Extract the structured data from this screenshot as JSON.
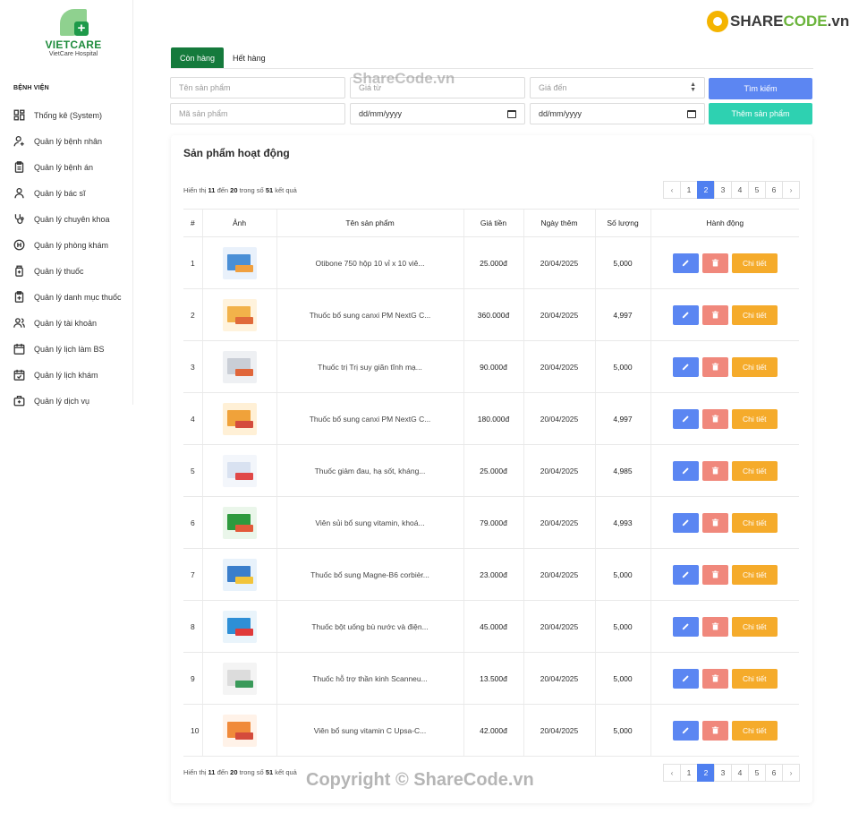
{
  "logo": {
    "name": "VIETCARE",
    "subtitle": "VietCare Hospital"
  },
  "brand": {
    "text_a": "SHARE",
    "text_b": "CODE",
    "text_c": ".vn"
  },
  "sidebar": {
    "section": "BỆNH VIỆN",
    "items": [
      {
        "label": "Thống kê (System)",
        "icon": "dashboard-icon"
      },
      {
        "label": "Quản lý bệnh nhân",
        "icon": "user-plus-icon"
      },
      {
        "label": "Quản lý bệnh án",
        "icon": "clipboard-icon"
      },
      {
        "label": "Quản lý bác sĩ",
        "icon": "user-icon"
      },
      {
        "label": "Quản lý chuyên khoa",
        "icon": "stethoscope-icon"
      },
      {
        "label": "Quản lý phòng khám",
        "icon": "hospital-icon"
      },
      {
        "label": "Quản lý thuốc",
        "icon": "medicine-bottle-icon"
      },
      {
        "label": "Quản lý danh mục thuốc",
        "icon": "clipboard-medical-icon"
      },
      {
        "label": "Quản lý tài khoản",
        "icon": "users-icon"
      },
      {
        "label": "Quản lý lịch làm BS",
        "icon": "calendar-icon"
      },
      {
        "label": "Quản lý lịch khám",
        "icon": "calendar-check-icon"
      },
      {
        "label": "Quản lý dịch vụ",
        "icon": "briefcase-medical-icon"
      }
    ]
  },
  "tabs": {
    "active": "Còn hàng",
    "inactive": "Hết hàng"
  },
  "filters": {
    "name_placeholder": "Tên sản phẩm",
    "price_from_placeholder": "Giá từ",
    "price_to_placeholder": "Giá đến",
    "code_placeholder": "Mã sản phẩm",
    "date_from": "dd/mm/yyyy",
    "date_to": "dd/mm/yyyy",
    "search_label": "Tìm kiếm",
    "add_label": "Thêm sản phẩm"
  },
  "card": {
    "title": "Sản phẩm hoạt động",
    "info_prefix": "Hiển thị",
    "info_from": "11",
    "info_mid": "đến",
    "info_to": "20",
    "info_mid2": "trong số",
    "info_total": "51",
    "info_suffix": "kết quả"
  },
  "pagination": {
    "prev": "‹",
    "next": "›",
    "pages": [
      "1",
      "2",
      "3",
      "4",
      "5",
      "6"
    ],
    "active_page": "2"
  },
  "table": {
    "headers": [
      "#",
      "Ảnh",
      "Tên sản phẩm",
      "Giá tiền",
      "Ngày thêm",
      "Số lượng",
      "Hành động"
    ],
    "detail_label": "Chi tiết",
    "rows": [
      {
        "idx": "1",
        "name": "Otibone 750 hộp 10 vỉ x 10 viê...",
        "price": "25.000đ",
        "date": "20/04/2025",
        "qty": "5,000"
      },
      {
        "idx": "2",
        "name": "Thuốc bổ sung canxi PM NextG C...",
        "price": "360.000đ",
        "date": "20/04/2025",
        "qty": "4,997"
      },
      {
        "idx": "3",
        "name": "Thuốc trị Trị suy giãn tĩnh mạ...",
        "price": "90.000đ",
        "date": "20/04/2025",
        "qty": "5,000"
      },
      {
        "idx": "4",
        "name": "Thuốc bổ sung canxi PM NextG C...",
        "price": "180.000đ",
        "date": "20/04/2025",
        "qty": "4,997"
      },
      {
        "idx": "5",
        "name": "Thuốc giảm đau, hạ sốt, kháng...",
        "price": "25.000đ",
        "date": "20/04/2025",
        "qty": "4,985"
      },
      {
        "idx": "6",
        "name": "Viên sủi bổ sung vitamin, khoá...",
        "price": "79.000đ",
        "date": "20/04/2025",
        "qty": "4,993"
      },
      {
        "idx": "7",
        "name": "Thuốc bổ sung Magne-B6 corbièr...",
        "price": "23.000đ",
        "date": "20/04/2025",
        "qty": "5,000"
      },
      {
        "idx": "8",
        "name": "Thuốc bột uống bù nước và điện...",
        "price": "45.000đ",
        "date": "20/04/2025",
        "qty": "5,000"
      },
      {
        "idx": "9",
        "name": "Thuốc hỗ trợ thần kinh Scanneu...",
        "price": "13.500đ",
        "date": "20/04/2025",
        "qty": "5,000"
      },
      {
        "idx": "10",
        "name": "Viên bổ sung vitamin C Upsa-C...",
        "price": "42.000đ",
        "date": "20/04/2025",
        "qty": "5,000"
      }
    ]
  },
  "watermarks": {
    "top": "ShareCode.vn",
    "bottom": "Copyright © ShareCode.vn"
  },
  "colors": {
    "primary_green": "#157a3c",
    "blue": "#5b86f2",
    "teal": "#2ed1b1",
    "red": "#f0887c",
    "orange": "#f5ab2b"
  }
}
